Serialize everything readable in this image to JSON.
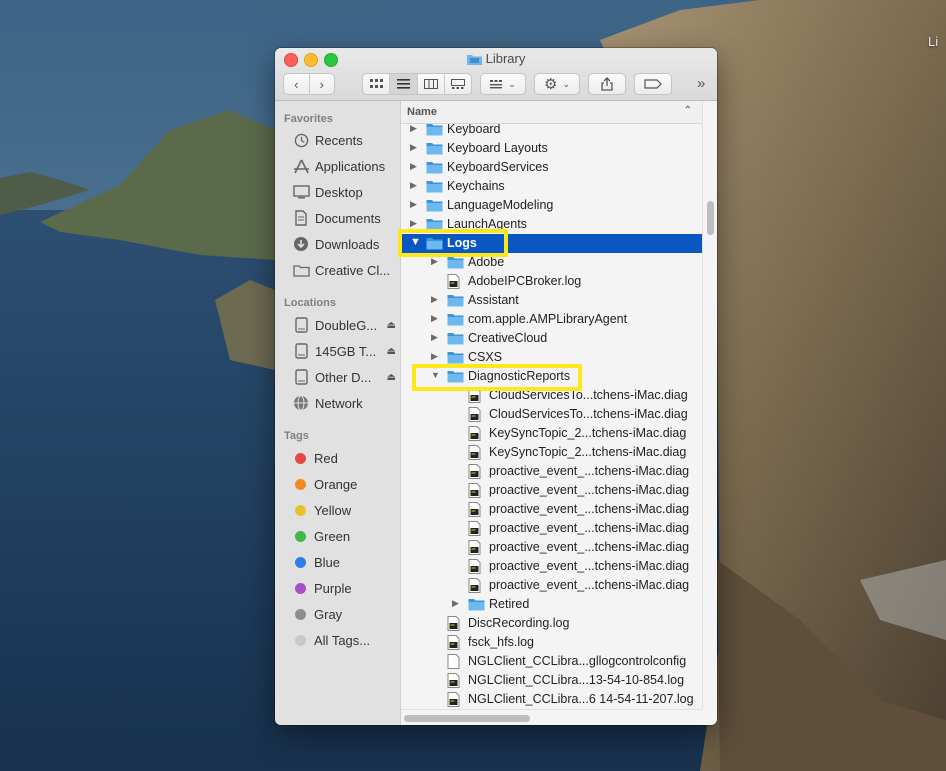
{
  "desktop": {
    "corner_label": "Li"
  },
  "window": {
    "title": "Library",
    "overflow_glyph": "»"
  },
  "colors": {
    "selection": "#0a57c4",
    "highlight_box": "#ffe81a",
    "folder": "#5aa9e6"
  },
  "sidebar": {
    "favorites_header": "Favorites",
    "favorites": [
      {
        "label": "Recents",
        "icon": "clock-icon"
      },
      {
        "label": "Applications",
        "icon": "applications-icon"
      },
      {
        "label": "Desktop",
        "icon": "desktop-icon"
      },
      {
        "label": "Documents",
        "icon": "document-icon"
      },
      {
        "label": "Downloads",
        "icon": "download-icon"
      },
      {
        "label": "Creative Cl...",
        "icon": "folder-icon"
      }
    ],
    "locations_header": "Locations",
    "locations": [
      {
        "label": "DoubleG...",
        "icon": "drive-icon"
      },
      {
        "label": "145GB T...",
        "icon": "drive-icon"
      },
      {
        "label": "Other D...",
        "icon": "drive-icon"
      },
      {
        "label": "Network",
        "icon": "globe-icon"
      }
    ],
    "tags_header": "Tags",
    "tags": [
      {
        "label": "Red",
        "color": "#e8473f"
      },
      {
        "label": "Orange",
        "color": "#f08a24"
      },
      {
        "label": "Yellow",
        "color": "#e6c32a"
      },
      {
        "label": "Green",
        "color": "#3fb84a"
      },
      {
        "label": "Blue",
        "color": "#2f7fe6"
      },
      {
        "label": "Purple",
        "color": "#a64fc9"
      },
      {
        "label": "Gray",
        "color": "#8e8e8e"
      },
      {
        "label": "All Tags...",
        "color": "#c9c9c9"
      }
    ]
  },
  "list": {
    "column_name": "Name",
    "rows": [
      {
        "label": "Keyboard",
        "kind": "folder",
        "depth": 0,
        "expand": "closed"
      },
      {
        "label": "Keyboard Layouts",
        "kind": "folder",
        "depth": 0,
        "expand": "closed"
      },
      {
        "label": "KeyboardServices",
        "kind": "folder",
        "depth": 0,
        "expand": "closed"
      },
      {
        "label": "Keychains",
        "kind": "folder",
        "depth": 0,
        "expand": "closed"
      },
      {
        "label": "LanguageModeling",
        "kind": "folder",
        "depth": 0,
        "expand": "closed"
      },
      {
        "label": "LaunchAgents",
        "kind": "folder",
        "depth": 0,
        "expand": "closed"
      },
      {
        "label": "Logs",
        "kind": "folder",
        "depth": 0,
        "expand": "open",
        "selected": true
      },
      {
        "label": "Adobe",
        "kind": "folder",
        "depth": 1,
        "expand": "closed"
      },
      {
        "label": "AdobeIPCBroker.log",
        "kind": "log",
        "depth": 1,
        "expand": "none"
      },
      {
        "label": "Assistant",
        "kind": "folder",
        "depth": 1,
        "expand": "closed"
      },
      {
        "label": "com.apple.AMPLibraryAgent",
        "kind": "folder",
        "depth": 1,
        "expand": "closed"
      },
      {
        "label": "CreativeCloud",
        "kind": "folder",
        "depth": 1,
        "expand": "closed"
      },
      {
        "label": "CSXS",
        "kind": "folder",
        "depth": 1,
        "expand": "closed"
      },
      {
        "label": "DiagnosticReports",
        "kind": "folder",
        "depth": 1,
        "expand": "open"
      },
      {
        "label": "CloudServicesTo...tchens-iMac.diag",
        "kind": "log",
        "depth": 2,
        "expand": "none"
      },
      {
        "label": "CloudServicesTo...tchens-iMac.diag",
        "kind": "log",
        "depth": 2,
        "expand": "none"
      },
      {
        "label": "KeySyncTopic_2...tchens-iMac.diag",
        "kind": "log",
        "depth": 2,
        "expand": "none"
      },
      {
        "label": "KeySyncTopic_2...tchens-iMac.diag",
        "kind": "log",
        "depth": 2,
        "expand": "none"
      },
      {
        "label": "proactive_event_...tchens-iMac.diag",
        "kind": "log",
        "depth": 2,
        "expand": "none"
      },
      {
        "label": "proactive_event_...tchens-iMac.diag",
        "kind": "log",
        "depth": 2,
        "expand": "none"
      },
      {
        "label": "proactive_event_...tchens-iMac.diag",
        "kind": "log",
        "depth": 2,
        "expand": "none"
      },
      {
        "label": "proactive_event_...tchens-iMac.diag",
        "kind": "log",
        "depth": 2,
        "expand": "none"
      },
      {
        "label": "proactive_event_...tchens-iMac.diag",
        "kind": "log",
        "depth": 2,
        "expand": "none"
      },
      {
        "label": "proactive_event_...tchens-iMac.diag",
        "kind": "log",
        "depth": 2,
        "expand": "none"
      },
      {
        "label": "proactive_event_...tchens-iMac.diag",
        "kind": "log",
        "depth": 2,
        "expand": "none"
      },
      {
        "label": "Retired",
        "kind": "folder",
        "depth": 2,
        "expand": "closed"
      },
      {
        "label": "DiscRecording.log",
        "kind": "log",
        "depth": 1,
        "expand": "none"
      },
      {
        "label": "fsck_hfs.log",
        "kind": "log",
        "depth": 1,
        "expand": "none"
      },
      {
        "label": "NGLClient_CCLibra...gllogcontrolconfig",
        "kind": "file",
        "depth": 1,
        "expand": "none"
      },
      {
        "label": "NGLClient_CCLibra...13-54-10-854.log",
        "kind": "log",
        "depth": 1,
        "expand": "none"
      },
      {
        "label": "NGLClient_CCLibra...6 14-54-11-207.log",
        "kind": "log",
        "depth": 1,
        "expand": "none"
      }
    ]
  }
}
